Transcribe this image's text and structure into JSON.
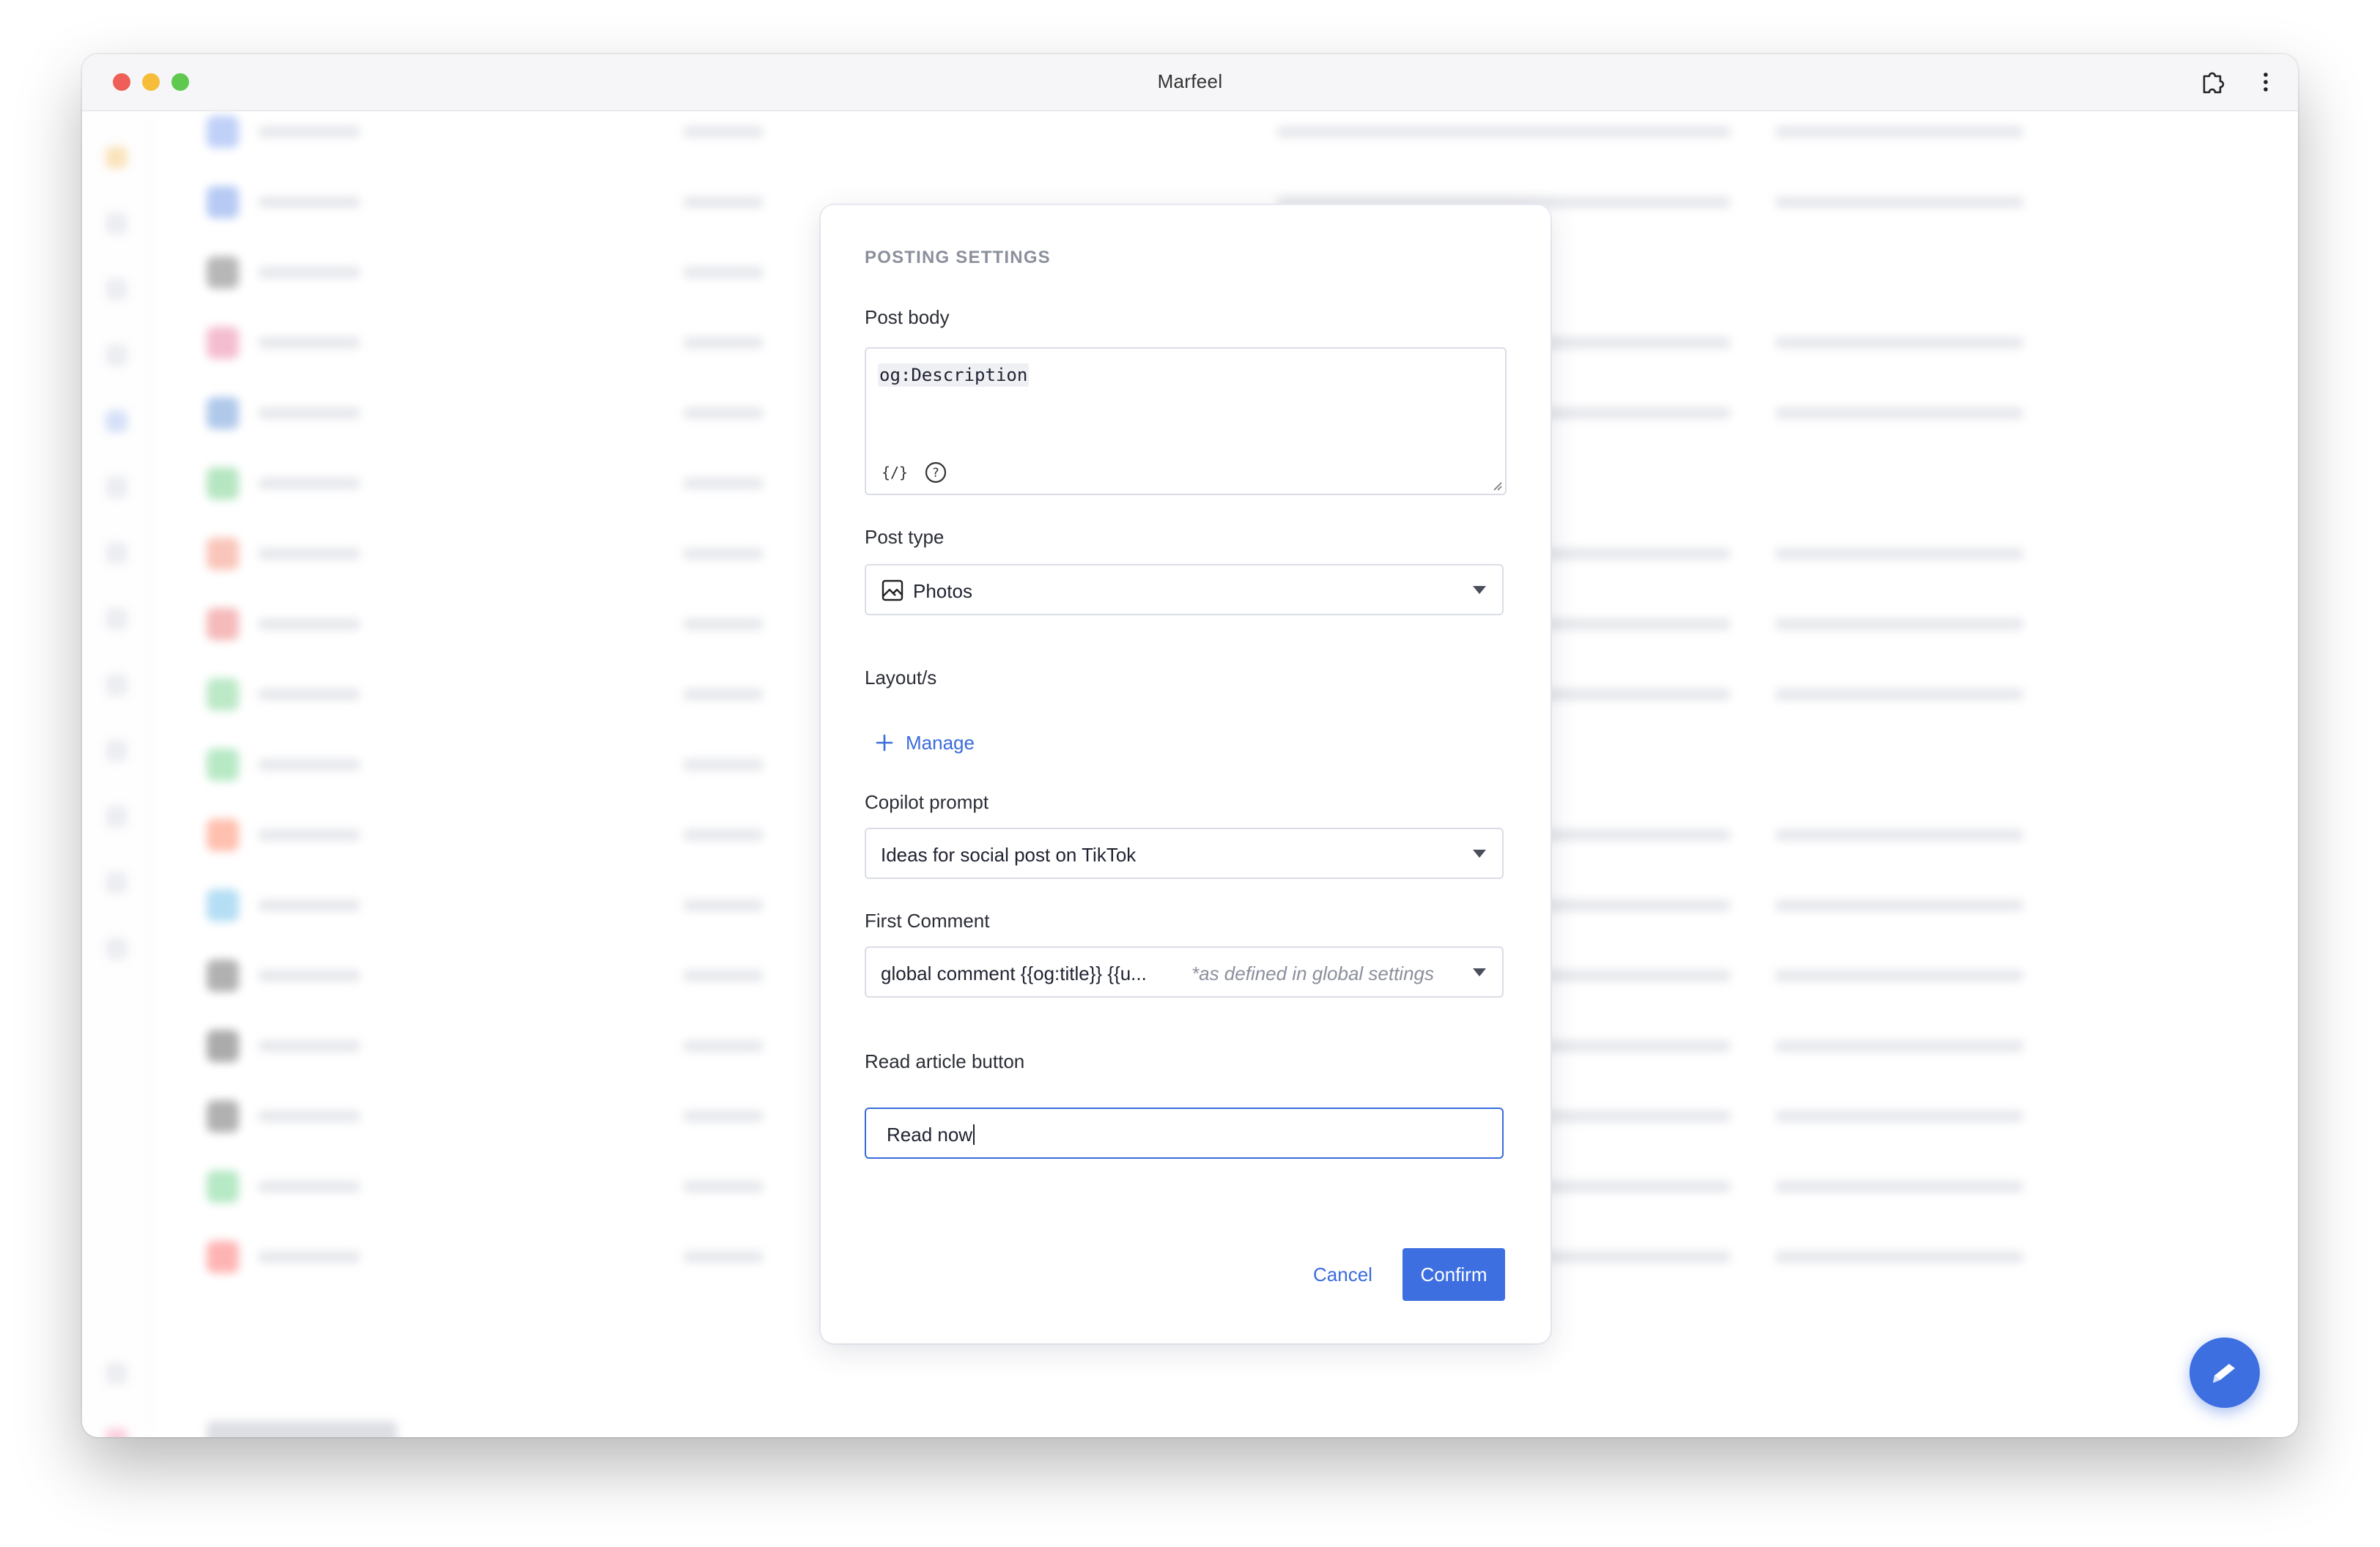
{
  "window": {
    "title": "Marfeel"
  },
  "dialog": {
    "title": "POSTING SETTINGS",
    "post_body": {
      "label": "Post body",
      "value": "og:Description"
    },
    "post_type": {
      "label": "Post type",
      "value": "Photos",
      "icon": "image-icon"
    },
    "layouts": {
      "label": "Layout/s",
      "manage_label": "Manage"
    },
    "copilot_prompt": {
      "label": "Copilot prompt",
      "value": "Ideas for social post on TikTok"
    },
    "first_comment": {
      "label": "First Comment",
      "value": "global comment {{og:title}} {{u...",
      "hint": "*as defined in global settings"
    },
    "read_article_button": {
      "label": "Read article button",
      "value": "Read now"
    },
    "buttons": {
      "cancel": "Cancel",
      "confirm": "Confirm"
    }
  },
  "colors": {
    "accent": "#3d6fe0",
    "link": "#3a6bdc"
  }
}
